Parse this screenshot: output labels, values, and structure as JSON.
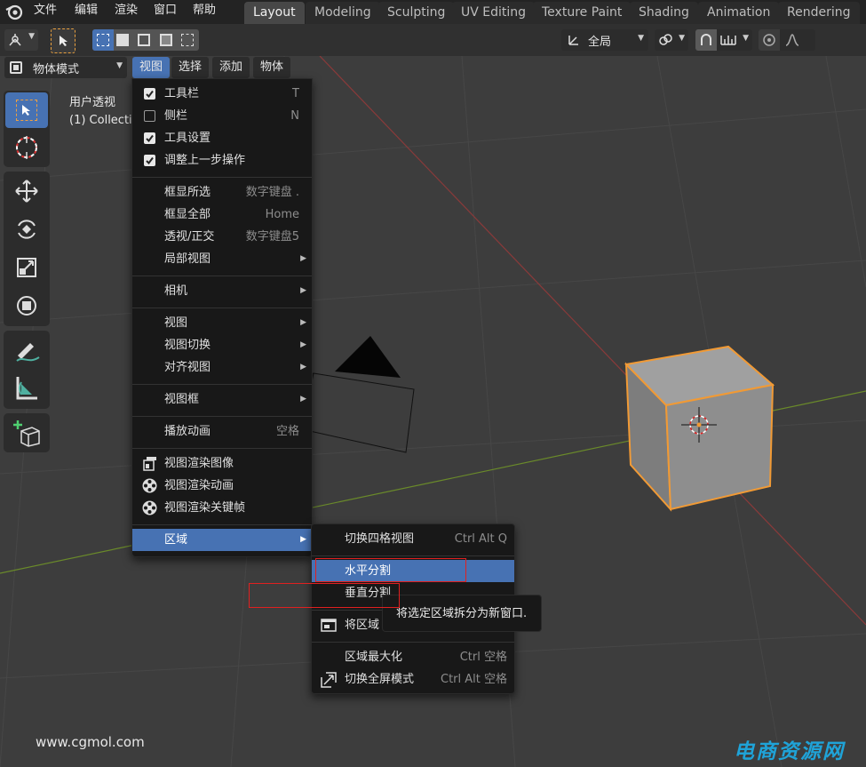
{
  "topbar": {
    "menus": [
      "文件",
      "编辑",
      "渲染",
      "窗口",
      "帮助"
    ],
    "workspaces": [
      "Layout",
      "Modeling",
      "Sculpting",
      "UV Editing",
      "Texture Paint",
      "Shading",
      "Animation",
      "Rendering"
    ],
    "active_workspace": "Layout"
  },
  "header": {
    "transform_orientation": "全局",
    "mode": "物体模式",
    "view_menus": [
      "视图",
      "选择",
      "添加",
      "物体"
    ]
  },
  "viewport": {
    "view_name": "用户透视",
    "collection": "(1) Collectio"
  },
  "view_menu": {
    "items": [
      {
        "label": "工具栏",
        "shortcut": "T",
        "check": "on"
      },
      {
        "label": "侧栏",
        "shortcut": "N",
        "check": "off"
      },
      {
        "label": "工具设置",
        "shortcut": "",
        "check": "on"
      },
      {
        "label": "调整上一步操作",
        "shortcut": "",
        "check": "on"
      },
      {
        "label": "框显所选",
        "shortcut": "数字键盘 .",
        "check": ""
      },
      {
        "label": "框显全部",
        "shortcut": "Home",
        "check": ""
      },
      {
        "label": "透视/正交",
        "shortcut": "数字键盘5",
        "check": ""
      },
      {
        "label": "局部视图",
        "shortcut": "",
        "submenu": true
      },
      {
        "label": "相机",
        "shortcut": "",
        "submenu": true
      },
      {
        "label": "视图",
        "shortcut": "",
        "submenu": true
      },
      {
        "label": "视图切换",
        "shortcut": "",
        "submenu": true
      },
      {
        "label": "对齐视图",
        "shortcut": "",
        "submenu": true
      },
      {
        "label": "视图框",
        "shortcut": "",
        "submenu": true
      },
      {
        "label": "播放动画",
        "shortcut": "空格"
      },
      {
        "label": "视图渲染图像",
        "icon": "render-image-icon"
      },
      {
        "label": "视图渲染动画",
        "icon": "render-animation-icon"
      },
      {
        "label": "视图渲染关键帧",
        "icon": "render-animation-icon"
      },
      {
        "label": "区域",
        "submenu": true,
        "highlighted": true
      }
    ]
  },
  "area_submenu": {
    "items": [
      {
        "label": "切换四格视图",
        "shortcut": "Ctrl Alt Q"
      },
      {
        "label": "水平分割",
        "shortcut": "",
        "highlighted": true
      },
      {
        "label": "垂直分割",
        "shortcut": ""
      },
      {
        "label": "将区域",
        "shortcut": ""
      },
      {
        "label": "区域最大化",
        "shortcut": "Ctrl 空格"
      },
      {
        "label": "切换全屏模式",
        "shortcut": "Ctrl Alt 空格"
      }
    ]
  },
  "tooltip": "将选定区域拆分为新窗口.",
  "watermark": {
    "left": "www.cgmol.com",
    "right": "电商资源网"
  }
}
